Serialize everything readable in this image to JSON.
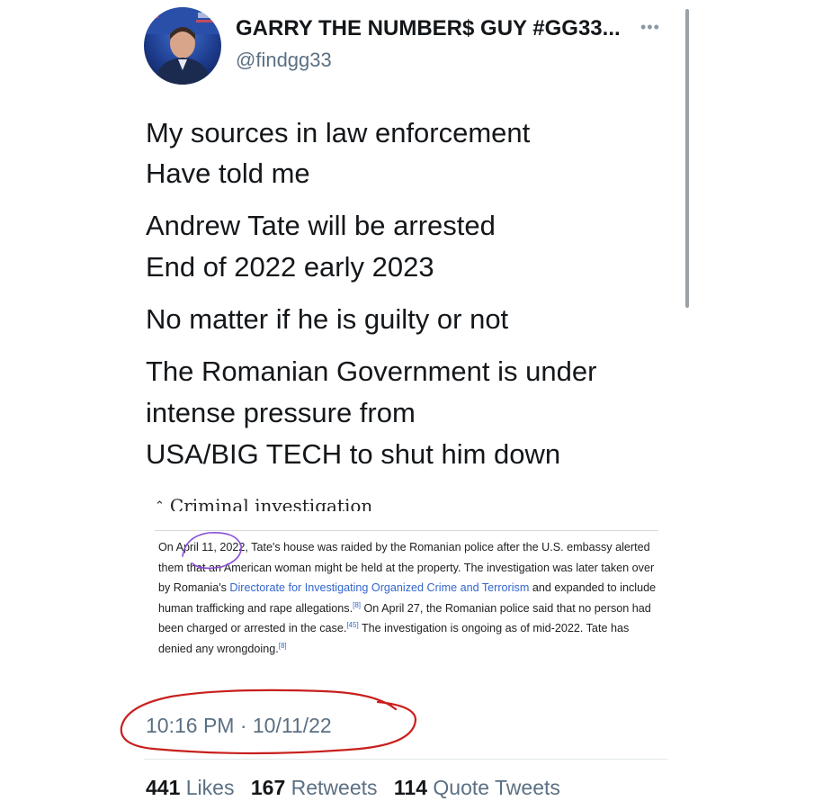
{
  "tweet": {
    "author": {
      "display_name": "GARRY THE NUMBER$ GUY #GG33...",
      "handle": "@findgg33"
    },
    "more_icon": "more-horizontal-icon",
    "lines": [
      "My sources in law enforcement",
      "Have told me",
      "Andrew Tate will be arrested",
      "End of 2022 early 2023",
      "No matter if he is guilty or not",
      "The Romanian Government is under",
      "intense pressure from",
      "USA/BIG TECH to shut him down"
    ],
    "timestamp": "10:16 PM · 10/11/22",
    "stats": {
      "likes_count": "441",
      "likes_label": "Likes",
      "retweets_count": "167",
      "retweets_label": "Retweets",
      "quotes_count": "114",
      "quotes_label": "Quote Tweets"
    }
  },
  "wiki_screenshot": {
    "section_title": "Criminal investigation",
    "caret_icon": "chevron-up-icon",
    "text": {
      "p1": "On April 11, 2022, Tate's house was raided by the Romanian police after the U.S. embassy alerted them that an American woman might be held at the property. The investigation was later taken over by Romania's ",
      "link": "Directorate for Investigating Organized Crime and Terrorism",
      "p2": " and expanded to include human trafficking and rape allegations.",
      "ref1": "[8]",
      "p3": " On April 27, the Romanian police said that no person had been charged or arrested in the case.",
      "ref2": "[45]",
      "p4": " The investigation is ongoing as of mid-2022. Tate has denied any wrongdoing.",
      "ref3": "[8]"
    }
  },
  "colors": {
    "text_primary": "#14171a",
    "text_secondary": "#5b7083",
    "wiki_link": "#3366cc",
    "annotation_red": "#c8201e",
    "annotation_purple": "#8a4fd8"
  }
}
